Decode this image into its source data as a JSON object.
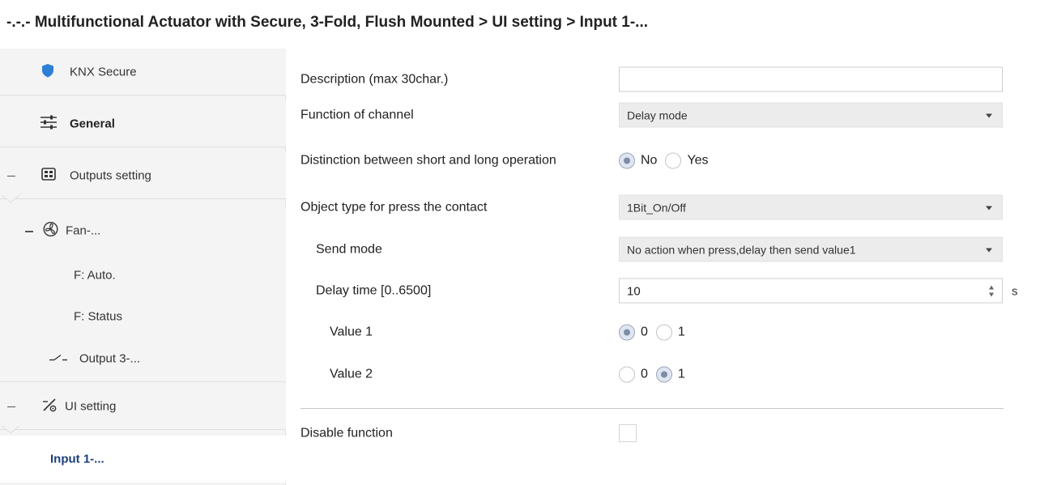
{
  "window": {
    "title": "-.-.- Multifunctional Actuator with Secure, 3-Fold, Flush Mounted > UI setting > Input 1-..."
  },
  "sidebar": {
    "items": [
      {
        "label": "KNX Secure",
        "icon": "shield-icon"
      },
      {
        "label": "General",
        "icon": "sliders-icon"
      },
      {
        "label": "Outputs setting",
        "icon": "module-icon"
      },
      {
        "label": "Fan-...",
        "icon": "fan-icon"
      },
      {
        "label": "F: Auto."
      },
      {
        "label": "F: Status"
      },
      {
        "label": "Output 3-...",
        "icon": "switch-icon"
      },
      {
        "label": "UI setting",
        "icon": "ui-setting-icon"
      },
      {
        "label": "Input 1-..."
      }
    ]
  },
  "form": {
    "description": {
      "label": "Description (max 30char.)",
      "value": ""
    },
    "function_of_channel": {
      "label": "Function of channel",
      "value": "Delay mode"
    },
    "distinction": {
      "label": "Distinction between short and long operation",
      "options": [
        "No",
        "Yes"
      ],
      "selected": "No"
    },
    "object_type": {
      "label": "Object type for press the contact",
      "value": "1Bit_On/Off"
    },
    "send_mode": {
      "label": "Send mode",
      "value": "No action when press,delay then send value1"
    },
    "delay_time": {
      "label": "Delay time [0..6500]",
      "value": "10",
      "unit": "s"
    },
    "value1": {
      "label": "Value 1",
      "options": [
        "0",
        "1"
      ],
      "selected": "0"
    },
    "value2": {
      "label": "Value 2",
      "options": [
        "0",
        "1"
      ],
      "selected": "1"
    },
    "disable_function": {
      "label": "Disable function",
      "checked": false
    }
  },
  "colors": {
    "accent": "#1c3f7a",
    "shield": "#2d7fd6",
    "sidebar_bg": "#f4f4f4",
    "select_bg": "#ececec"
  }
}
